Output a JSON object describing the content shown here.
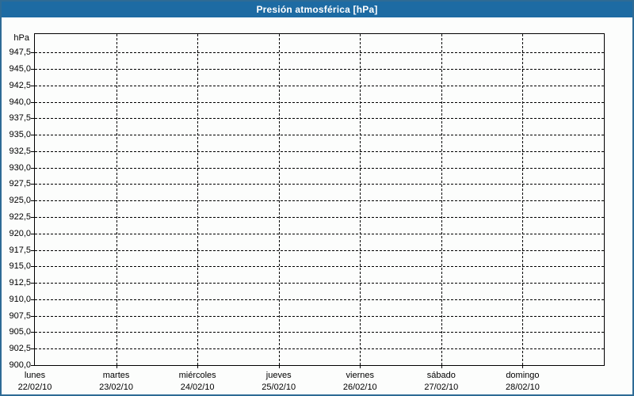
{
  "window": {
    "title": "Presión atmosférica [hPa]"
  },
  "colors": {
    "titlebar_bg": "#1d6ba3",
    "titlebar_text": "#ffffff",
    "window_border": "#2e6b95",
    "window_bg": "#fcfdfc",
    "grid": "#000000",
    "axis": "#000000",
    "label_text": "#000000"
  },
  "chart_data": {
    "type": "line",
    "title": "Presión atmosférica [hPa]",
    "y_unit_label": "hPa",
    "ylabel": "hPa",
    "xlabel": "",
    "ylim": [
      900,
      950.3
    ],
    "ytick_step": 2.5,
    "grid": "dashed",
    "legend": "none",
    "yticks": [
      {
        "value": 947.5,
        "label": "947,5"
      },
      {
        "value": 945.0,
        "label": "945,0"
      },
      {
        "value": 942.5,
        "label": "942,5"
      },
      {
        "value": 940.0,
        "label": "940,0"
      },
      {
        "value": 937.5,
        "label": "937,5"
      },
      {
        "value": 935.0,
        "label": "935,0"
      },
      {
        "value": 932.5,
        "label": "932,5"
      },
      {
        "value": 930.0,
        "label": "930,0"
      },
      {
        "value": 927.5,
        "label": "927,5"
      },
      {
        "value": 925.0,
        "label": "925,0"
      },
      {
        "value": 922.5,
        "label": "922,5"
      },
      {
        "value": 920.0,
        "label": "920,0"
      },
      {
        "value": 917.5,
        "label": "917,5"
      },
      {
        "value": 915.0,
        "label": "915,0"
      },
      {
        "value": 912.5,
        "label": "912,5"
      },
      {
        "value": 910.0,
        "label": "910,0"
      },
      {
        "value": 907.5,
        "label": "907,5"
      },
      {
        "value": 905.0,
        "label": "905,0"
      },
      {
        "value": 902.5,
        "label": "902,5"
      },
      {
        "value": 900.0,
        "label": "900,0"
      }
    ],
    "x_categories": [
      {
        "day": "lunes",
        "date": "22/02/10"
      },
      {
        "day": "martes",
        "date": "23/02/10"
      },
      {
        "day": "miércoles",
        "date": "24/02/10"
      },
      {
        "day": "jueves",
        "date": "25/02/10"
      },
      {
        "day": "viernes",
        "date": "26/02/10"
      },
      {
        "day": "sábado",
        "date": "27/02/10"
      },
      {
        "day": "domingo",
        "date": "28/02/10"
      }
    ],
    "series": []
  }
}
